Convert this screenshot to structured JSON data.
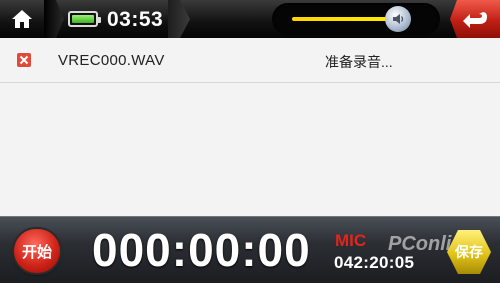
{
  "status": {
    "time": "03:53",
    "battery_level": 1.0,
    "volume_level": 0.75
  },
  "recordings": [
    {
      "name": "VREC000.WAV",
      "status": "准备录音..."
    }
  ],
  "controls": {
    "start_label": "开始",
    "timer": "000:00:00",
    "input_source": "MIC",
    "remaining_time": "042:20:05",
    "save_label": "保存"
  },
  "watermark": "PConline",
  "colors": {
    "accent_red": "#d0241a",
    "volume_yellow": "#ffd500",
    "save_yellow": "#e2c318"
  }
}
